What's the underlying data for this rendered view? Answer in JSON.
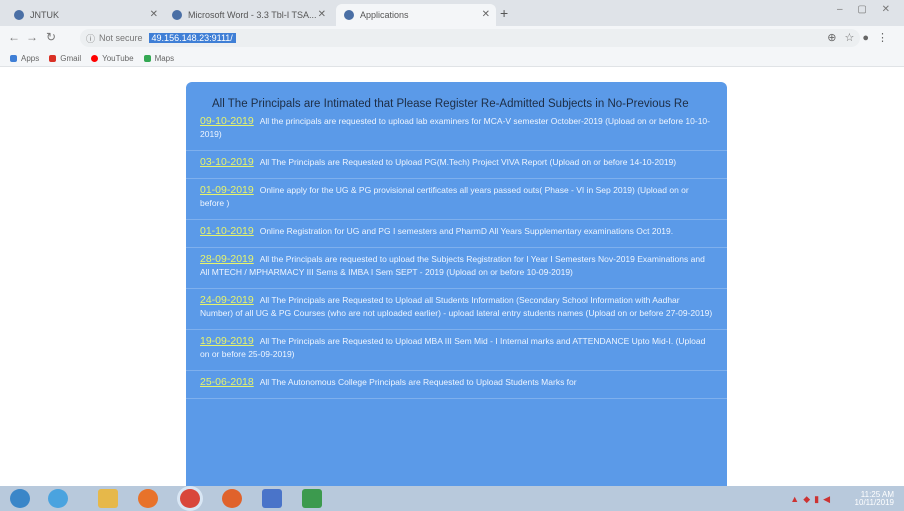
{
  "browser": {
    "tabs": [
      {
        "label": "JNTUK",
        "active": false
      },
      {
        "label": "Microsoft Word - 3.3 Tbl-I TSA...",
        "active": false
      },
      {
        "label": "Applications",
        "active": true
      }
    ],
    "new_tab": "+",
    "window_controls": "– ▢ ✕",
    "address": {
      "security_label": "Not secure",
      "url": "49.156.148.23:9111/"
    },
    "bookmarks": [
      {
        "label": "Apps",
        "color": "#3f7fd6"
      },
      {
        "label": "Gmail",
        "color": "#d93025"
      },
      {
        "label": "YouTube",
        "color": "#ff0000"
      },
      {
        "label": "Maps",
        "color": "#34a853"
      }
    ]
  },
  "marquee": "All The Principals are Intimated that Please Register Re-Admitted Subjects in No-Previous Re",
  "notices": [
    {
      "date": "09-10-2019",
      "text": "All the principals are requested to upload lab examiners for MCA-V semester October-2019 (Upload on or before 10-10-2019)"
    },
    {
      "date": "03-10-2019",
      "text": "All The Principals are Requested to Upload PG(M.Tech) Project VIVA Report (Upload on or before 14-10-2019)"
    },
    {
      "date": "01-09-2019",
      "text": "Online apply for the UG & PG provisional certificates all years passed outs( Phase - VI in Sep 2019) (Upload on or before )"
    },
    {
      "date": "01-10-2019",
      "text": "Online Registration for UG and PG I semesters and PharmD All Years Supplementary examinations Oct 2019."
    },
    {
      "date": "28-09-2019",
      "text": "All the Principals are requested to upload the Subjects Registration for I Year I Semesters Nov-2019 Examinations and All MTECH / MPHARMACY III Sems & IMBA I Sem SEPT - 2019 (Upload on or before 10-09-2019)"
    },
    {
      "date": "24-09-2019",
      "text": "All The Principals are Requested to Upload all Students Information (Secondary School Information with Aadhar Number) of all UG & PG Courses (who are not uploaded earlier) - upload lateral entry students names (Upload on or before 27-09-2019)"
    },
    {
      "date": "19-09-2019",
      "text": "All The Principals are Requested to Upload MBA III Sem Mid - I Internal marks and ATTENDANCE Upto Mid-I. (Upload on or before 25-09-2019)"
    },
    {
      "date": "25-06-2018",
      "text": "All The Autonomous College Principals are Requested to Upload Students Marks for"
    }
  ],
  "taskbar": {
    "apps": [
      {
        "name": "start",
        "color": "#3a86c8"
      },
      {
        "name": "ie",
        "color": "#4aa3df"
      },
      {
        "name": "explorer",
        "color": "#e6b84a"
      },
      {
        "name": "media",
        "color": "#e8722a"
      },
      {
        "name": "chrome",
        "color": "#d9463b"
      },
      {
        "name": "firefox",
        "color": "#e0622b"
      },
      {
        "name": "word",
        "color": "#4a74c9"
      },
      {
        "name": "excel",
        "color": "#3c9a4e"
      }
    ],
    "clock_time": "11:25 AM",
    "clock_date": "10/11/2019"
  }
}
